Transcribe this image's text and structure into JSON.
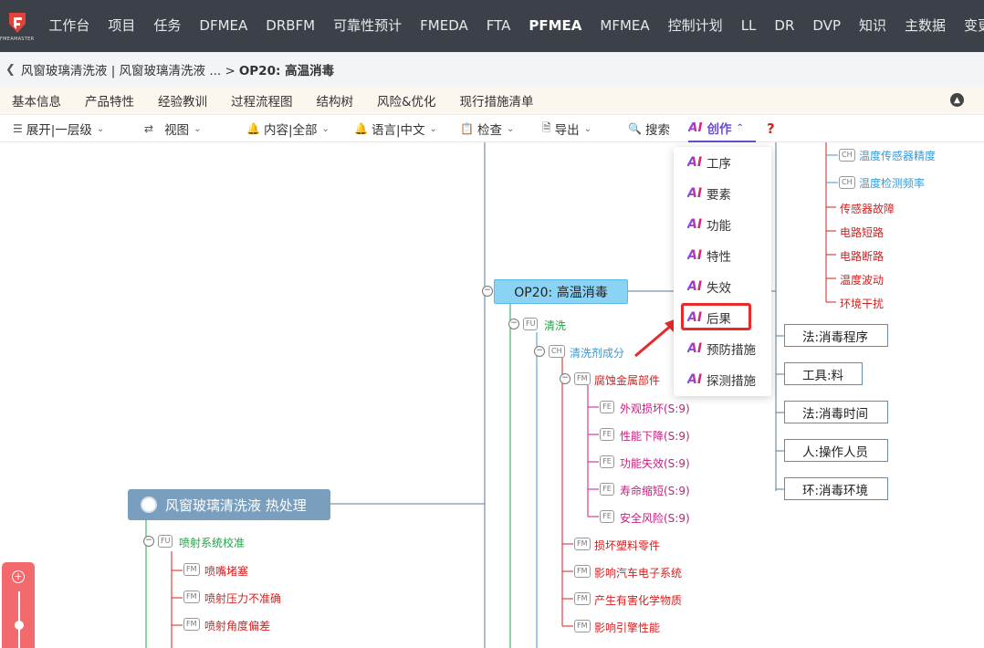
{
  "nav": {
    "logo_text": "FMEAMASTER",
    "items": [
      "工作台",
      "项目",
      "任务",
      "DFMEA",
      "DRBFM",
      "可靠性预计",
      "FMEDA",
      "FTA",
      "PFMEA",
      "MFMEA",
      "控制计划",
      "LL",
      "DR",
      "DVP",
      "知识",
      "主数据",
      "变更"
    ],
    "active": "PFMEA"
  },
  "breadcrumb": {
    "path": "风窗玻璃清洗液 | 风窗玻璃清洗液 ... >",
    "current": "OP20: 高温消毒"
  },
  "tabs": [
    "基本信息",
    "产品特性",
    "经验教训",
    "过程流程图",
    "结构树",
    "风险&优化",
    "现行措施清单"
  ],
  "toolbar": {
    "expand": "展开|一层级",
    "view": "视图",
    "content": "内容|全部",
    "language": "语言|中文",
    "check": "检查",
    "export": "导出",
    "search": "搜索",
    "create": "创作",
    "help": "?"
  },
  "ai_menu": {
    "prefix": "AI",
    "items": [
      "工序",
      "要素",
      "功能",
      "特性",
      "失效",
      "后果",
      "预防措施",
      "探测措施"
    ],
    "highlighted": "后果"
  },
  "tree": {
    "root": "风窗玻璃清洗液 热处理",
    "op": "OP20: 高温消毒",
    "fu_clean": "清洗",
    "ch_agent": "清洗剂成分",
    "fm_corrode": "腐蚀金属部件",
    "effects": [
      "外观损坏(S:9)",
      "性能下降(S:9)",
      "功能失效(S:9)",
      "寿命缩短(S:9)",
      "安全风险(S:9)"
    ],
    "fm_others": [
      "损坏塑料零件",
      "影响汽车电子系统",
      "产生有害化学物质",
      "影响引擎性能"
    ],
    "fu_spray": "喷射系统校准",
    "fm_spray": [
      "喷嘴堵塞",
      "喷射压力不准确",
      "喷射角度偏差"
    ],
    "ch_top": [
      "温度传感器精度",
      "温度检测频率"
    ],
    "fm_top": [
      "传感器故障",
      "电路短路",
      "电路断路",
      "温度波动",
      "环境干扰"
    ],
    "factors": [
      "法:消毒程序",
      "工具:料",
      "法:消毒时间",
      "人:操作人员",
      "环:消毒环境"
    ],
    "tag_fu": "FU",
    "tag_ch": "CH",
    "tag_fm": "FM",
    "tag_fe": "FE"
  },
  "colors": {
    "nav_bg": "#3c4049",
    "accent": "#6a4bd8",
    "highlight": "#e82a2a",
    "root_node": "#7a9fbe",
    "op_node": "#8bd3f5",
    "zoom_widget": "#f36a6e"
  }
}
